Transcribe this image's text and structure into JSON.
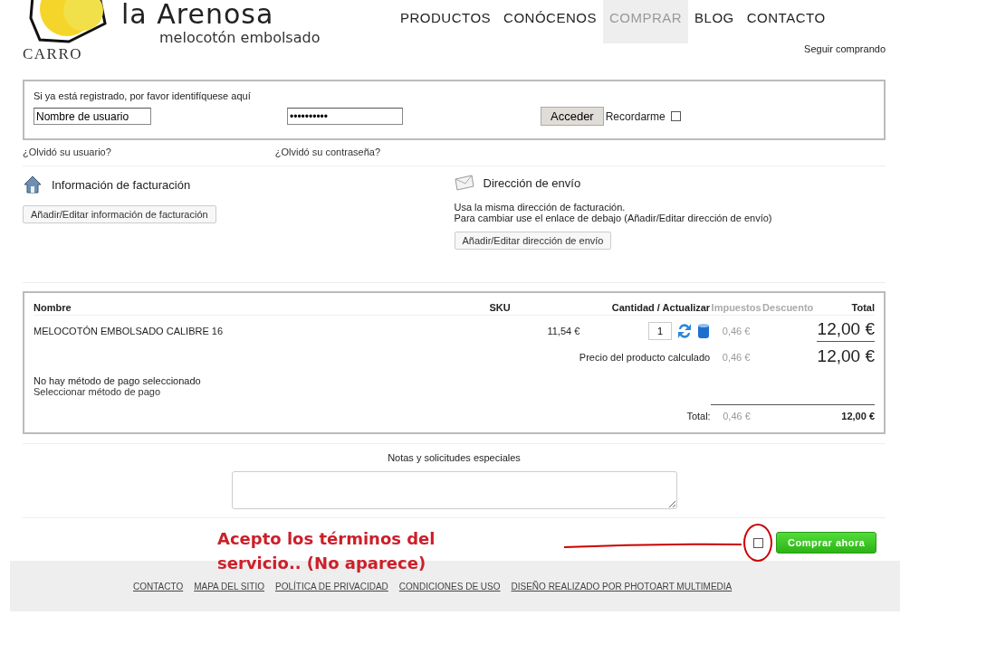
{
  "logo": {
    "name": "la Arenosa",
    "tagline": "melocotón embolsado"
  },
  "nav": [
    {
      "label": "PRODUCTOS",
      "selected": false
    },
    {
      "label": "CONÓCENOS",
      "selected": false
    },
    {
      "label": "COMPRAR",
      "selected": true
    },
    {
      "label": "BLOG",
      "selected": false
    },
    {
      "label": "CONTACTO",
      "selected": false
    }
  ],
  "page_title": "CARRO",
  "continue_link": "Seguir comprando",
  "login": {
    "prompt": "Si ya está registrado, por favor identifíquese aquí",
    "username": "Nombre de usuario",
    "password": "••••••••••",
    "submit": "Acceder",
    "remember": "Recordarme",
    "remember_checked": false,
    "forgot_user": "¿Olvidó su usuario?",
    "forgot_password": "¿Olvidó su contraseña?"
  },
  "billing": {
    "title": "Información de facturación",
    "button": "Añadir/Editar información de facturación"
  },
  "shipping": {
    "title": "Dirección de envío",
    "note": "Usa la misma dirección de facturación.",
    "hint": "Para cambiar use el enlace de debajo (Añadir/Editar dirección de envío)",
    "button": "Añadir/Editar dirección de envío"
  },
  "cart": {
    "columns": [
      "Nombre",
      "SKU",
      "Cantidad / Actualizar",
      "Impuestos",
      "Descuento",
      "Total"
    ],
    "item": {
      "name": "MELOCOTÓN EMBOLSADO CALIBRE 16",
      "price": "11,54 €",
      "quantity": "1",
      "tax": "0,46 €",
      "total": "12,00 €"
    },
    "subtotal": {
      "label": "Precio del producto calculado",
      "tax": "0,46 €",
      "total": "12,00 €"
    },
    "payment": {
      "status": "No hay método de pago seleccionado",
      "link": "Seleccionar método de pago"
    },
    "grand_total": {
      "label": "Total:",
      "tax": "0,46 €",
      "total": "12,00 €"
    }
  },
  "notes_label": "Notas y solicitudes especiales",
  "annotation": "Acepto los términos del servicio.. (No aparece)",
  "terms_checked": false,
  "buy_button": "Comprar ahora",
  "footer_links": [
    "CONTACTO",
    "MAPA DEL SITIO",
    "POLÍTICA DE PRIVACIDAD",
    "CONDICIONES DE USO",
    "DISEÑO REALIZADO POR PHOTOART MULTIMEDIA"
  ]
}
